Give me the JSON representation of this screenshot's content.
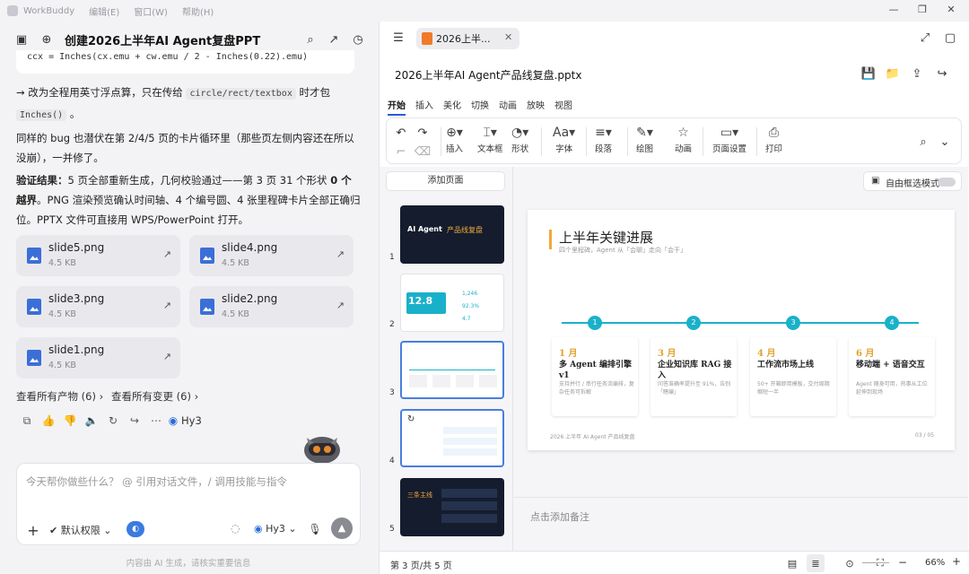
{
  "window": {
    "app_name": "WorkBuddy",
    "menu": [
      "编辑(E)",
      "窗口(W)",
      "帮助(H)"
    ],
    "controls": [
      "—",
      "❐",
      "✕"
    ]
  },
  "chat": {
    "title": "创建2026上半年AI Agent复盘PPT",
    "code_snippet": "ccx = Inches(cx.emu + cw.emu / 2 - Inches(0.22).emu)",
    "p1_a": "→ 改为全程用英寸浮点算，只在传给",
    "p1_code1": "circle/rect/textbox",
    "p1_b": "时才包",
    "p1_code2": "Inches()",
    "p1_c": "。",
    "p2": "同样的 bug 也潜伏在第 2/4/5 页的卡片循环里（那些页左侧内容还在所以没崩），一并修了。",
    "p3_bold": "验证结果：",
    "p3_a": "5 页全部重新生成，几何校验通过——第 3 页 31 个形状 ",
    "p3_bold2": "0 个越界",
    "p3_b": "。PNG 渲染预览确认时间轴、4 个编号圆、4 张里程碑卡片全部正确归位。PPTX 文件可直接用 WPS/PowerPoint 打开。",
    "files": [
      {
        "name": "slide5.png",
        "size": "4.5 KB"
      },
      {
        "name": "slide4.png",
        "size": "4.5 KB"
      },
      {
        "name": "slide3.png",
        "size": "4.5 KB"
      },
      {
        "name": "slide2.png",
        "size": "4.5 KB"
      },
      {
        "name": "slide1.png",
        "size": "4.5 KB"
      }
    ],
    "view_all_outputs": "查看所有产物 (6) ›",
    "view_all_changes": "查看所有变更 (6) ›",
    "model_name": "Hy3",
    "input_placeholder": "今天帮你做些什么？ @ 引用对话文件，/ 调用技能与指令",
    "permission": "默认权限",
    "model_select": "Hy3",
    "footnote": "内容由 AI 生成，请核实重要信息"
  },
  "doc": {
    "tab_label": "2026上半...",
    "filename": "2026上半年AI Agent产品线复盘.pptx",
    "menu": [
      "开始",
      "插入",
      "美化",
      "切换",
      "动画",
      "放映",
      "视图"
    ],
    "ribbon": {
      "insert": "插入",
      "textbox": "文本框",
      "shape": "形状",
      "font": "字体",
      "paragraph": "段落",
      "draw": "绘图",
      "animation": "动画",
      "page_setup": "页面设置",
      "print": "打印"
    },
    "add_page": "添加页面",
    "free_select": "自由框选模式",
    "thumb_numbers": [
      "1",
      "2",
      "3",
      "4",
      "5"
    ],
    "thumb1": {
      "l1": "AI Agent",
      "l2": "产品线复盘"
    },
    "thumb2": {
      "big": "12.8",
      "unit": "亿元",
      "v1": "1,246",
      "v2": "92.3%",
      "v3": "4.7"
    },
    "thumb5": {
      "title": "三条主线"
    },
    "slide": {
      "title": "上半年关键进展",
      "subtitle": "四个里程碑，Agent 从「会聊」走向「会干」",
      "milestones": [
        {
          "n": "1",
          "month": "1 月",
          "title": "多 Agent 编排引擎 v1",
          "desc": "支持并行 / 串行任务流编排，复杂任务可拆解"
        },
        {
          "n": "2",
          "month": "3 月",
          "title": "企业知识库 RAG 接入",
          "desc": "问答准确率提升至 91%，告别「瞎编」"
        },
        {
          "n": "3",
          "month": "4 月",
          "title": "工作流市场上线",
          "desc": "50+ 开箱即用模板，交付周期缩短一半"
        },
        {
          "n": "4",
          "month": "6 月",
          "title": "移动端 + 语音交互",
          "desc": "Agent 随身可用，热事从工位延伸到现场"
        }
      ],
      "footer_left": "2026 上半年 AI Agent 产品线复盘",
      "footer_right": "03 / 05"
    },
    "notes_placeholder": "点击添加备注",
    "status_page": "第 3 页/共 5 页",
    "zoom": "66%"
  }
}
